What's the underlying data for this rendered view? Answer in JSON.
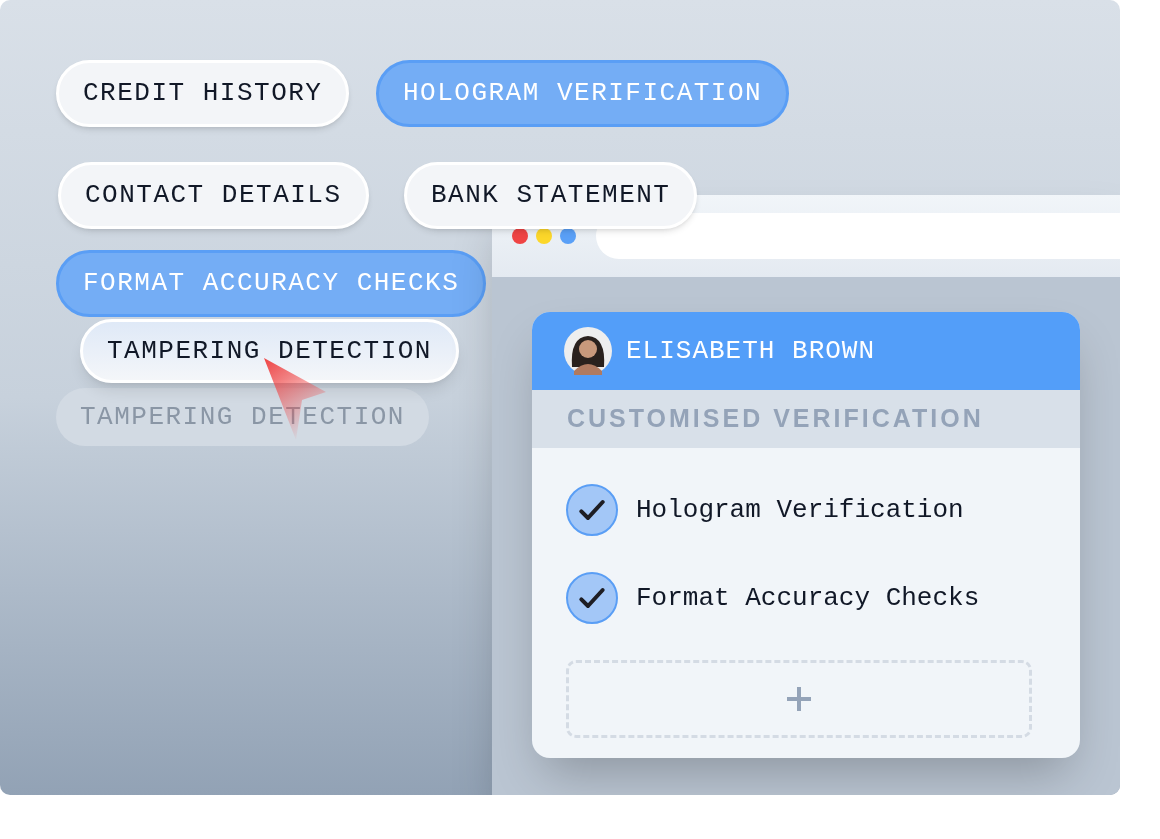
{
  "tags": [
    {
      "label": "CREDIT HISTORY",
      "selected": false
    },
    {
      "label": "HOLOGRAM VERIFICATION",
      "selected": true
    },
    {
      "label": "CONTACT DETAILS",
      "selected": false
    },
    {
      "label": "BANK STATEMENT",
      "selected": false
    },
    {
      "label": "FORMAT ACCURACY CHECKS",
      "selected": true
    }
  ],
  "dragged_tag": {
    "label": "TAMPERING DETECTION"
  },
  "drop_placeholder": {
    "label": "TAMPERING DETECTION"
  },
  "profile_card": {
    "name": "ELISABETH BROWN",
    "section_title": "CUSTOMISED VERIFICATION",
    "checks": [
      {
        "label": "Hologram Verification",
        "checked": true
      },
      {
        "label": "Format Accuracy Checks",
        "checked": true
      }
    ]
  }
}
